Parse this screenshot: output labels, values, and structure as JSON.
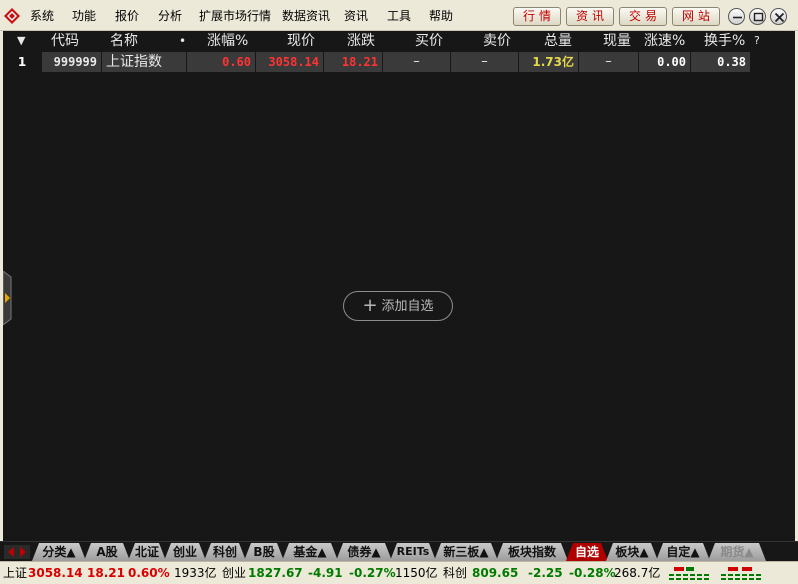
{
  "menu": [
    "系统",
    "功能",
    "报价",
    "分析",
    "扩展市场行情",
    "数据资讯",
    "资讯",
    "工具",
    "帮助"
  ],
  "quick_buttons": [
    "行情",
    "资讯",
    "交易",
    "网站"
  ],
  "header": {
    "sort_arrow": "▼",
    "columns": [
      "代码",
      "名称",
      "•",
      "涨幅%",
      "现价",
      "涨跌",
      "买价",
      "卖价",
      "总量",
      "现量",
      "涨速%",
      "换手%",
      "?"
    ]
  },
  "rows": [
    {
      "index": "1",
      "code": "999999",
      "name": "上证指数",
      "change_pct": "0.60",
      "price": "3058.14",
      "change": "18.21",
      "bid": "–",
      "ask": "–",
      "volume": "1.73亿",
      "cur_volume": "–",
      "speed": "0.00",
      "turnover": "0.38"
    }
  ],
  "add_button": {
    "icon": "+",
    "label": "添加自选"
  },
  "tabs": [
    {
      "label": "分类▲",
      "state": "normal"
    },
    {
      "label": "A股",
      "state": "normal"
    },
    {
      "label": "北证",
      "state": "normal"
    },
    {
      "label": "创业",
      "state": "normal"
    },
    {
      "label": "科创",
      "state": "normal"
    },
    {
      "label": "B股",
      "state": "normal"
    },
    {
      "label": "基金▲",
      "state": "normal"
    },
    {
      "label": "债券▲",
      "state": "normal"
    },
    {
      "label": "REITs",
      "state": "normal"
    },
    {
      "label": "新三板▲",
      "state": "normal"
    },
    {
      "label": "板块指数",
      "state": "normal"
    },
    {
      "label": "自选",
      "state": "active"
    },
    {
      "label": "板块▲",
      "state": "normal"
    },
    {
      "label": "自定▲",
      "state": "normal"
    },
    {
      "label": "期货▲",
      "state": "faded"
    }
  ],
  "status": {
    "sh_label": "上证",
    "sh_price": "3058.14",
    "sh_change": "18.21",
    "sh_pct": "0.60%",
    "sh_amount": "1933亿",
    "cy_label": "创业",
    "cy_price": "1827.67",
    "cy_change": "-4.91",
    "cy_pct": "-0.27%",
    "cy_amount": "1150亿",
    "kc_label": "科创",
    "kc_price": "809.65",
    "kc_change": "-2.25",
    "kc_pct": "-0.28%",
    "kc_amount": "268.7亿"
  },
  "colors": {
    "up": "#ff3333",
    "down": "#00aa00",
    "volume": "#e6d84a",
    "active_tab": "#b00000"
  }
}
